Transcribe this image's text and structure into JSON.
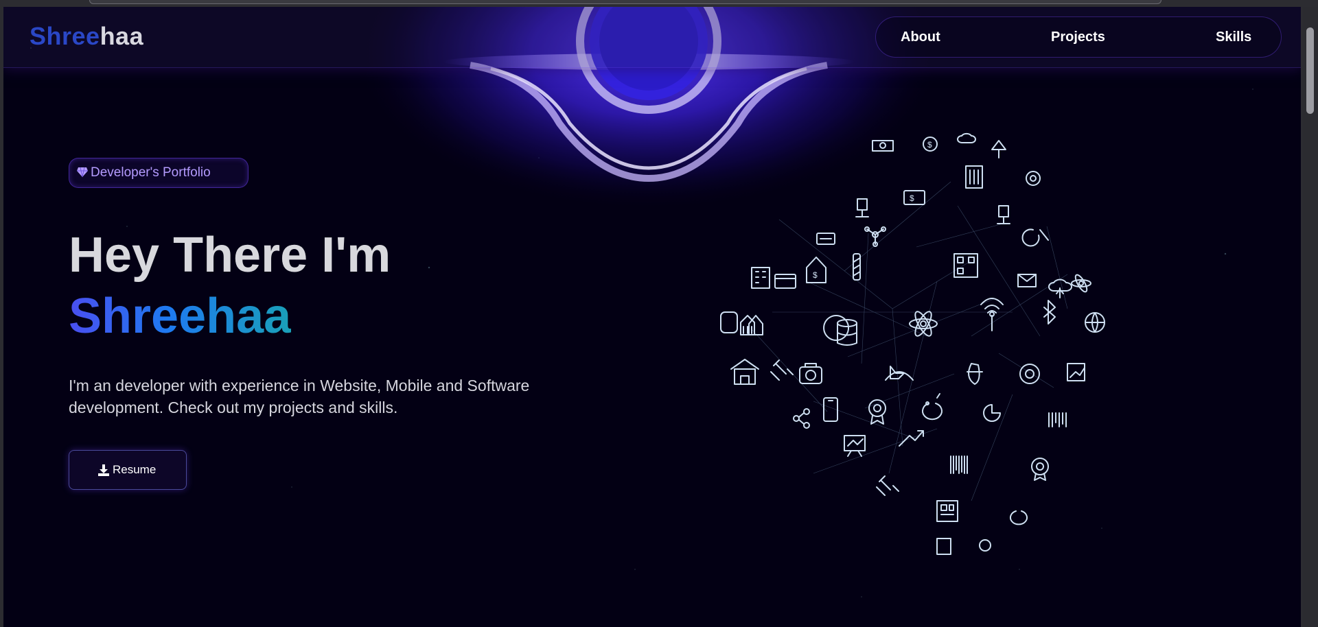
{
  "logo": {
    "part1": "Shree",
    "part2": "haa"
  },
  "nav": {
    "items": [
      {
        "label": "About"
      },
      {
        "label": "Projects"
      },
      {
        "label": "Skills"
      }
    ]
  },
  "hero": {
    "badge": "Developer's Portfolio",
    "greeting": "Hey There I'm",
    "name": "Shreehaa",
    "description": "I'm an developer with experience in Website, Mobile and Software development. Check out my projects and skills.",
    "resume_label": "Resume",
    "badge_icon": "gem-icon",
    "resume_icon": "download-icon"
  },
  "colors": {
    "background": "#030014",
    "accent": "#7042f8",
    "logo_primary": "#2a47c6",
    "gradient": [
      "#4a4ff0",
      "#1e7af0",
      "#1aa0b8"
    ]
  },
  "globe_icons": [
    "money-icon",
    "dollar-icon",
    "cloud-icon",
    "antenna-icon",
    "building-icon",
    "gear-icon",
    "chair-icon",
    "server-icon",
    "network-icon",
    "card-icon",
    "qr-code-icon",
    "mail-icon",
    "cloud-upload-icon",
    "atom-icon",
    "wallet-icon",
    "bank-icon",
    "database-icon",
    "wifi-icon",
    "bluetooth-icon",
    "globe-icon",
    "shop-icon",
    "satellite-icon",
    "camera-icon",
    "money-bag-icon",
    "chart-icon",
    "share-icon",
    "phone-icon",
    "award-icon",
    "piggy-bank-icon",
    "barcode-icon",
    "presentation-icon",
    "trend-icon"
  ]
}
